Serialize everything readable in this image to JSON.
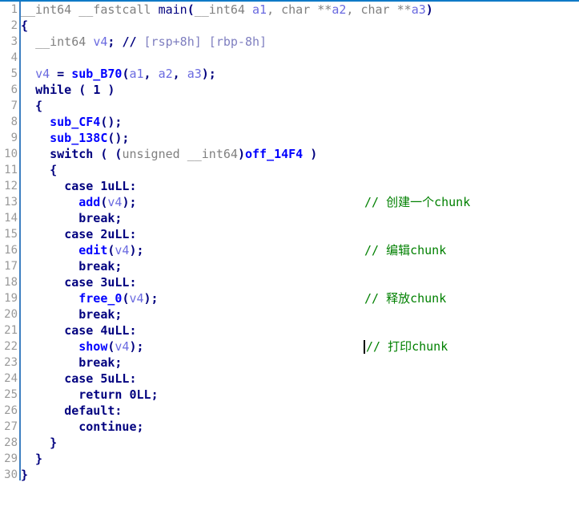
{
  "view": {
    "name": "pseudocode-view",
    "accent_color": "#0f7ac7",
    "gutter_rule_color": "#3d7fc1",
    "background_color": "#ffffff",
    "comment_color": "#008000",
    "keyword_color": "#00007f",
    "function_color": "#0000ff",
    "variable_color": "#6a6ae0",
    "type_color": "#808080",
    "lineno_color": "#999999",
    "total_lines": 30
  },
  "lines": [
    {
      "no": "1",
      "text": "__int64 __fastcall main(__int64 a1, char **a2, char **a3)"
    },
    {
      "no": "2",
      "text": "{"
    },
    {
      "no": "3",
      "text": "  __int64 v4; // [rsp+8h] [rbp-8h]"
    },
    {
      "no": "4",
      "text": ""
    },
    {
      "no": "5",
      "text": "  v4 = sub_B70(a1, a2, a3);"
    },
    {
      "no": "6",
      "text": "  while ( 1 )"
    },
    {
      "no": "7",
      "text": "  {"
    },
    {
      "no": "8",
      "text": "    sub_CF4();"
    },
    {
      "no": "9",
      "text": "    sub_138C();"
    },
    {
      "no": "10",
      "text": "    switch ( (unsigned __int64)off_14F4 )"
    },
    {
      "no": "11",
      "text": "    {"
    },
    {
      "no": "12",
      "text": "      case 1uLL:"
    },
    {
      "no": "13",
      "text": "        add(v4);"
    },
    {
      "no": "14",
      "text": "        break;"
    },
    {
      "no": "15",
      "text": "      case 2uLL:"
    },
    {
      "no": "16",
      "text": "        edit(v4);"
    },
    {
      "no": "17",
      "text": "        break;"
    },
    {
      "no": "18",
      "text": "      case 3uLL:"
    },
    {
      "no": "19",
      "text": "        free_0(v4);"
    },
    {
      "no": "20",
      "text": "        break;"
    },
    {
      "no": "21",
      "text": "      case 4uLL:"
    },
    {
      "no": "22",
      "text": "        show(v4);"
    },
    {
      "no": "23",
      "text": "        break;"
    },
    {
      "no": "24",
      "text": "      case 5uLL:"
    },
    {
      "no": "25",
      "text": "        return 0LL;"
    },
    {
      "no": "26",
      "text": "      default:"
    },
    {
      "no": "27",
      "text": "        continue;"
    },
    {
      "no": "28",
      "text": "    }"
    },
    {
      "no": "29",
      "text": "  }"
    },
    {
      "no": "30",
      "text": "}"
    }
  ],
  "side_comments": [
    {
      "line": "13",
      "text": "// 创建一个chunk"
    },
    {
      "line": "16",
      "text": "// 编辑chunk"
    },
    {
      "line": "19",
      "text": "// 释放chunk"
    },
    {
      "line": "22",
      "text": "// 打印chunk"
    }
  ],
  "caret": {
    "line": "22",
    "description": "text-cursor"
  }
}
